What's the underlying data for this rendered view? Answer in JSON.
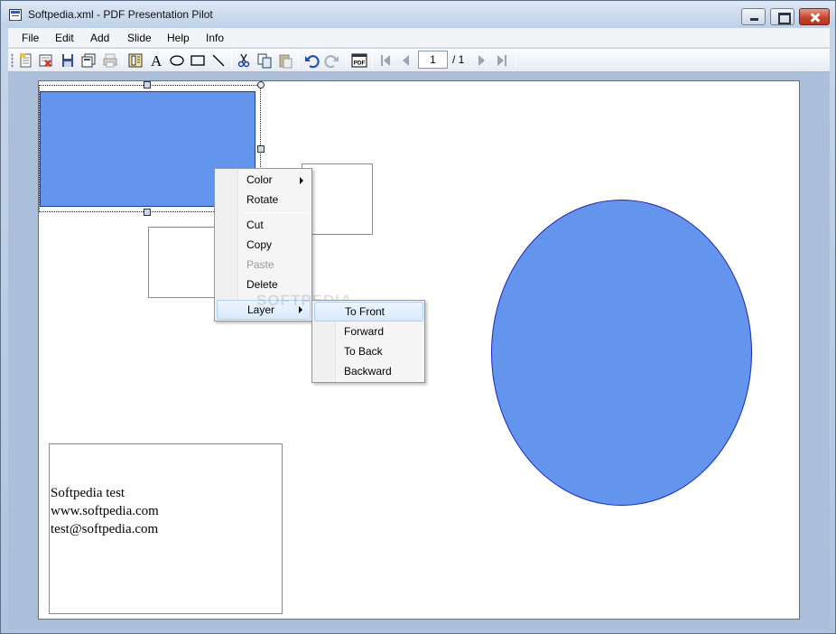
{
  "window": {
    "title": "Softpedia.xml - PDF Presentation Pilot"
  },
  "menubar": {
    "items": [
      "File",
      "Edit",
      "Add",
      "Slide",
      "Help",
      "Info"
    ]
  },
  "toolbar": {
    "buttons": [
      "new-icon",
      "close-file-icon",
      "save-icon",
      "save-all-icon",
      "print-icon",
      "layout-icon",
      "text-icon",
      "ellipse-icon",
      "rectangle-icon",
      "line-icon",
      "cut-icon",
      "copy-icon",
      "paste-icon",
      "undo-icon",
      "redo-icon",
      "pdf-icon",
      "first-page-icon",
      "previous-page-icon",
      "next-page-icon",
      "last-page-icon"
    ],
    "page_current": "1",
    "page_total": "/ 1"
  },
  "slide": {
    "textbox_lines": [
      "Softpedia test",
      "www.softpedia.com",
      "test@softpedia.com"
    ],
    "shape_fill": "#6495ED",
    "ellipse_stroke": "#1A24C8"
  },
  "context_menu": {
    "items": [
      {
        "label": "Color",
        "submenu": true
      },
      {
        "label": "Rotate"
      },
      {
        "label": "Cut"
      },
      {
        "label": "Copy"
      },
      {
        "label": "Paste",
        "disabled": true
      },
      {
        "label": "Delete"
      },
      {
        "label": "Layer",
        "submenu": true,
        "highlighted": true
      }
    ]
  },
  "layer_submenu": {
    "items": [
      {
        "label": "To Front",
        "highlighted": true
      },
      {
        "label": "Forward"
      },
      {
        "label": "To Back"
      },
      {
        "label": "Backward"
      }
    ]
  },
  "watermark": "SOFTPEDIA"
}
